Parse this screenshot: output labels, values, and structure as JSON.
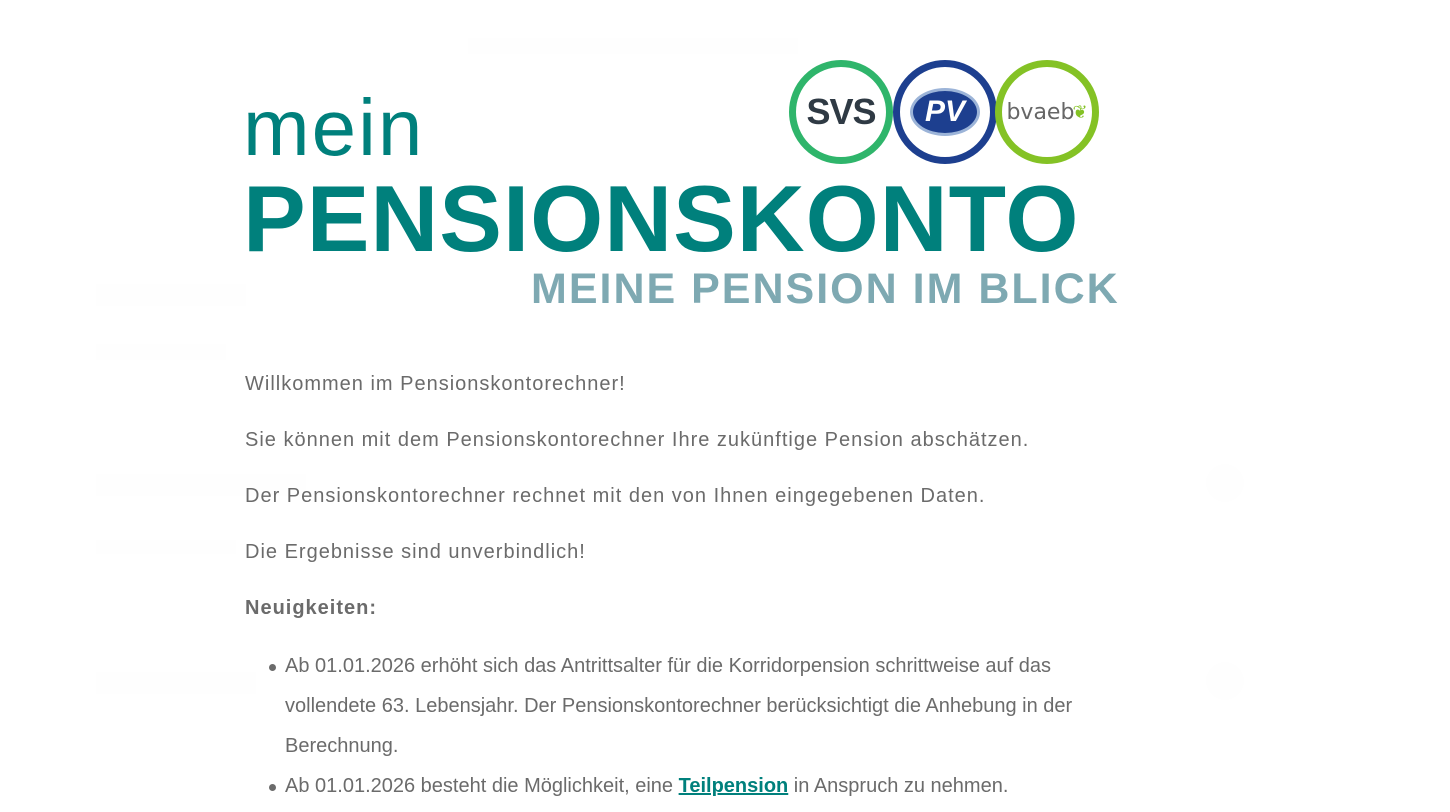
{
  "logo": {
    "line1": "mein",
    "line2": "PENSIONSKONTO",
    "claim": "MEINE PENSION IM BLICK",
    "badges": [
      "SVS",
      "PV",
      "bvaeb"
    ]
  },
  "intro": {
    "welcome": "Willkommen im Pensionskontorechner!",
    "line2": "Sie können mit dem Pensionskontorechner Ihre zukünftige Pension abschätzen.",
    "line3": "Der Pensionskontorechner rechnet mit den von Ihnen eingegebenen Daten.",
    "line4": "Die Ergebnisse sind unverbindlich!"
  },
  "news": {
    "title": "Neuigkeiten:",
    "item1": "Ab 01.01.2026 erhöht sich das Antrittsalter für die Korridorpension schrittweise auf das vollendete 63. Lebensjahr. Der Pensionskontorechner berücksichtigt die Anhebung in der Berechnung.",
    "item2_before": "Ab 01.01.2026 besteht die Möglichkeit, eine ",
    "item2_link": "Teilpension",
    "item2_after": " in Anspruch zu nehmen."
  },
  "colors": {
    "brand": "#00807c",
    "claim": "#7ea9b2",
    "svs": "#2fb56b",
    "pv": "#1d3f8f",
    "bvaeb": "#84c225"
  }
}
